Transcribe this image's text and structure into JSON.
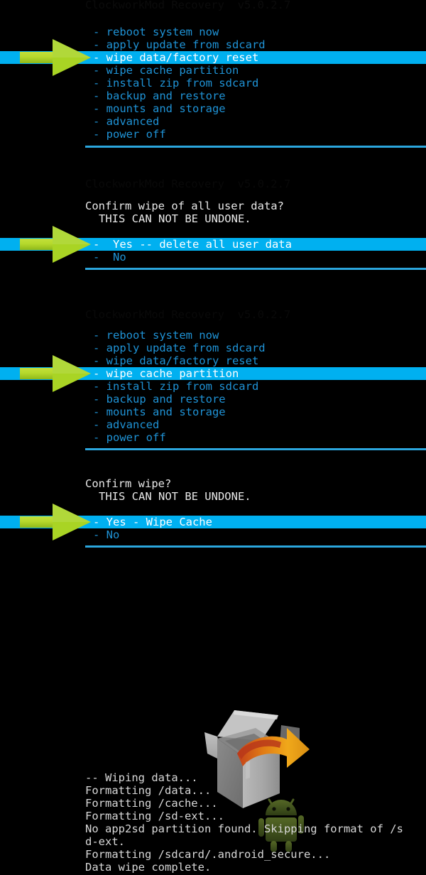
{
  "screen": {
    "title": "ClockworkMod Recovery",
    "background_color": "#000000",
    "text_color": "#1f93d6",
    "highlight_bg": "#00b0f0",
    "highlight_fg": "#ffffff",
    "divider_color": "#2ba6dd",
    "arrow_color": "#b6d92c",
    "log_color": "#d8d8d8"
  },
  "faded_headers": {
    "top": "ClockworkMod Recovery  v5.0.2.7",
    "second": "ClockworkMod Recovery  v5.0.2.7",
    "third": "ClockworkMod Recovery  v5.0.2.7"
  },
  "sections": [
    {
      "name": "main-menu-wipe-data",
      "items": [
        {
          "label": "- reboot system now",
          "selected": false
        },
        {
          "label": "- apply update from sdcard",
          "selected": false
        },
        {
          "label": "- wipe data/factory reset",
          "selected": true
        },
        {
          "label": "- wipe cache partition",
          "selected": false
        },
        {
          "label": "- install zip from sdcard",
          "selected": false
        },
        {
          "label": "- backup and restore",
          "selected": false
        },
        {
          "label": "- mounts and storage",
          "selected": false
        },
        {
          "label": "- advanced",
          "selected": false
        },
        {
          "label": "- power off",
          "selected": false
        }
      ]
    },
    {
      "name": "confirm-wipe-data",
      "prompt": "Confirm wipe of all user data?",
      "warning": "THIS CAN NOT BE UNDONE.",
      "items": [
        {
          "label": "-  Yes -- delete all user data",
          "selected": true
        },
        {
          "label": "-  No",
          "selected": false
        }
      ]
    },
    {
      "name": "main-menu-wipe-cache",
      "items": [
        {
          "label": "- reboot system now",
          "selected": false
        },
        {
          "label": "- apply update from sdcard",
          "selected": false
        },
        {
          "label": "- wipe data/factory reset",
          "selected": false
        },
        {
          "label": "- wipe cache partition",
          "selected": true
        },
        {
          "label": "- install zip from sdcard",
          "selected": false
        },
        {
          "label": "- backup and restore",
          "selected": false
        },
        {
          "label": "- mounts and storage",
          "selected": false
        },
        {
          "label": "- advanced",
          "selected": false
        },
        {
          "label": "- power off",
          "selected": false
        }
      ]
    },
    {
      "name": "confirm-wipe-cache",
      "prompt": "Confirm wipe?",
      "warning": "THIS CAN NOT BE UNDONE.",
      "items": [
        {
          "label": "- Yes - Wipe Cache",
          "selected": true
        },
        {
          "label": "- No",
          "selected": false
        }
      ]
    }
  ],
  "log": {
    "lines": [
      "-- Wiping data...",
      "Formatting /data...",
      "Formatting /cache...",
      "Formatting /sd-ext...",
      "No app2sd partition found. Skipping format of /s",
      "d-ext.",
      "Formatting /sdcard/.android_secure...",
      "Data wipe complete."
    ]
  },
  "artwork": {
    "install_box": "open-cardboard-box-icon",
    "android_robot": "android-robot-icon"
  }
}
